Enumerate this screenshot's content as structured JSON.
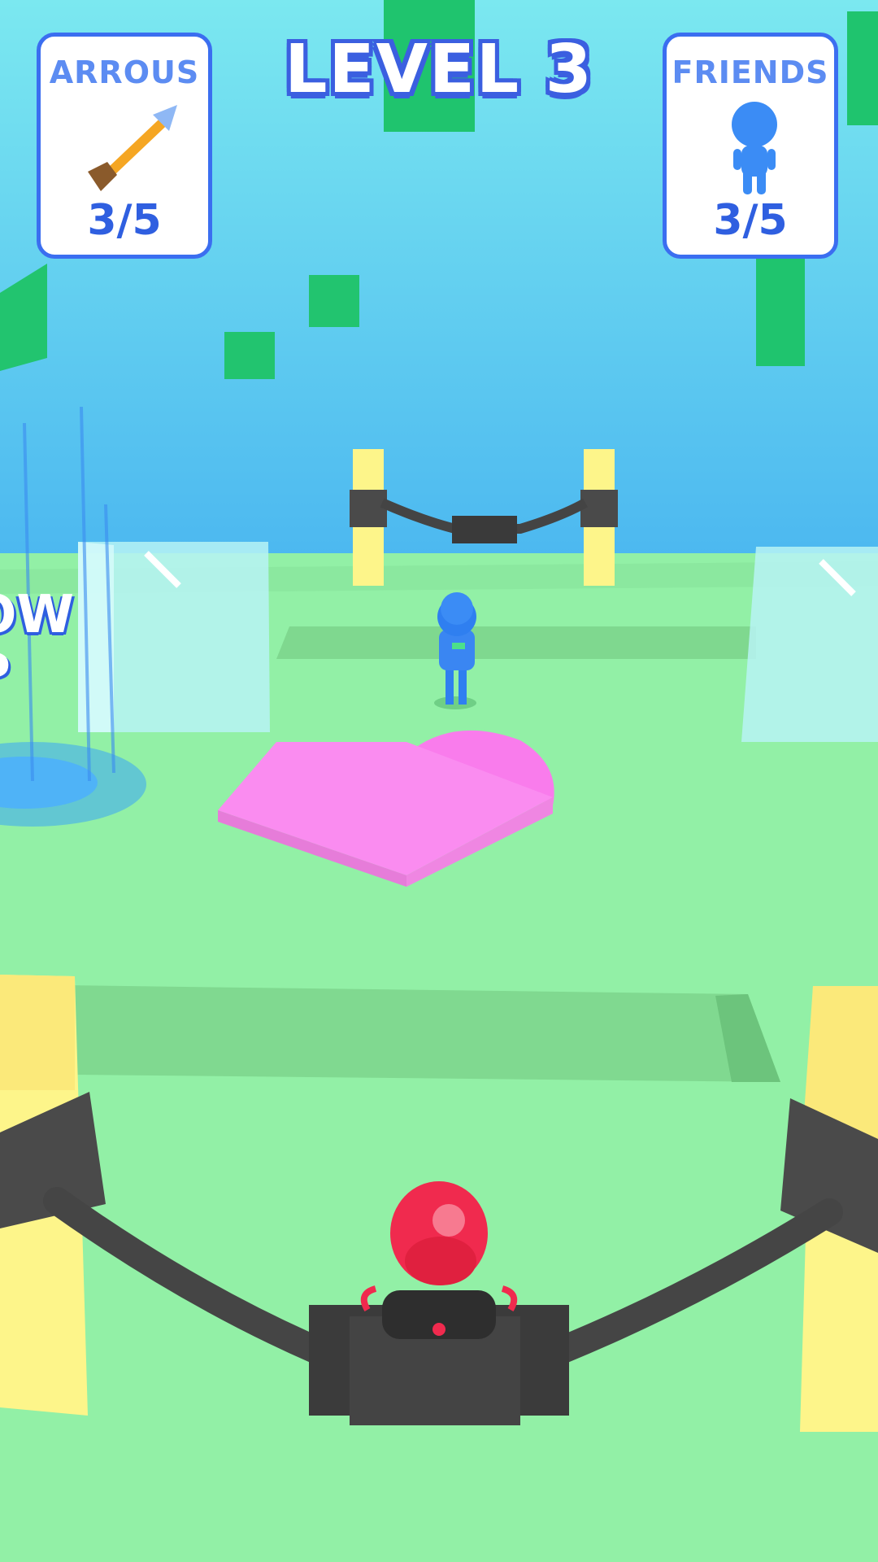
{
  "hud": {
    "level_title": "LEVEL 3",
    "arrows_label": "ARROUS",
    "arrows_count": "3/5",
    "friends_label": "FRIENDS",
    "friends_count": "3/5"
  },
  "signs": {
    "bow_powerup_line1": "OW",
    "bow_powerup_line2": "P"
  },
  "icons": {
    "arrow": "arrow-icon",
    "friend": "person-icon"
  },
  "colors": {
    "sky": "#6fe2f0",
    "ground": "#92f0a6",
    "hud_border": "#3b6ef0",
    "player": "#f02a4e",
    "enemy": "#2f7ff0",
    "pad": "#fa8cf0",
    "post": "#fdf58a"
  }
}
